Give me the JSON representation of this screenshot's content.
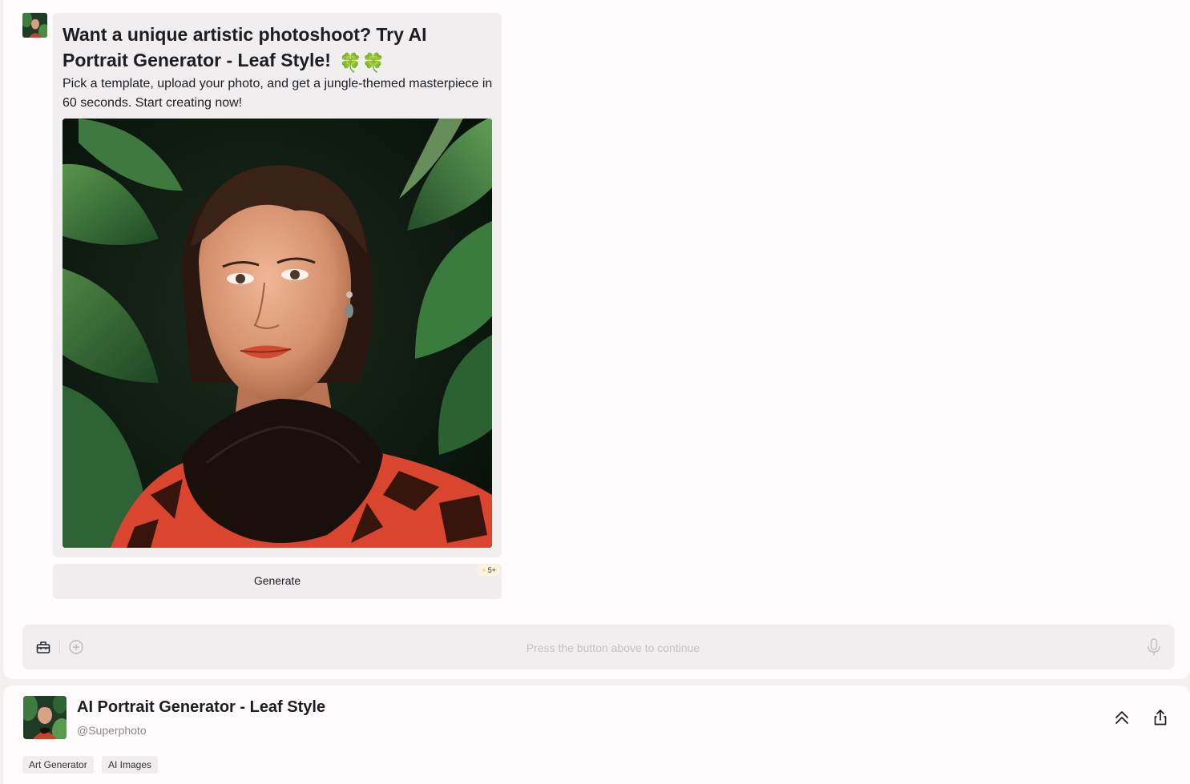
{
  "message": {
    "title": "Want a unique artistic photoshoot? Try AI Portrait Generator - Leaf Style!",
    "title_emoji": "🍀🍀",
    "body": "Pick a template, upload your photo, and get a jungle-themed masterpiece in 60 seconds. Start creating now!",
    "image": "portrait of a woman among dark green leaves wearing a red patterned jacket with black fur collar"
  },
  "generate": {
    "label": "Generate",
    "cost": "5+"
  },
  "input": {
    "placeholder": "Press the button above to continue"
  },
  "bot": {
    "name": "AI Portrait Generator - Leaf Style",
    "handle": "@Superphoto",
    "tags": [
      "Art Generator",
      "AI Images"
    ]
  },
  "icons": {
    "toolbox": "toolbox-icon",
    "add": "plus-circle-icon",
    "mic": "microphone-icon",
    "scroll_top": "double-chevron-up-icon",
    "share": "share-icon"
  },
  "colors": {
    "background": "#fdfbfb",
    "card": "#f0eeef",
    "badge": "#fbf3dc",
    "accent_jacket": "#e2533a",
    "leaf_green": "#2f5e33"
  }
}
